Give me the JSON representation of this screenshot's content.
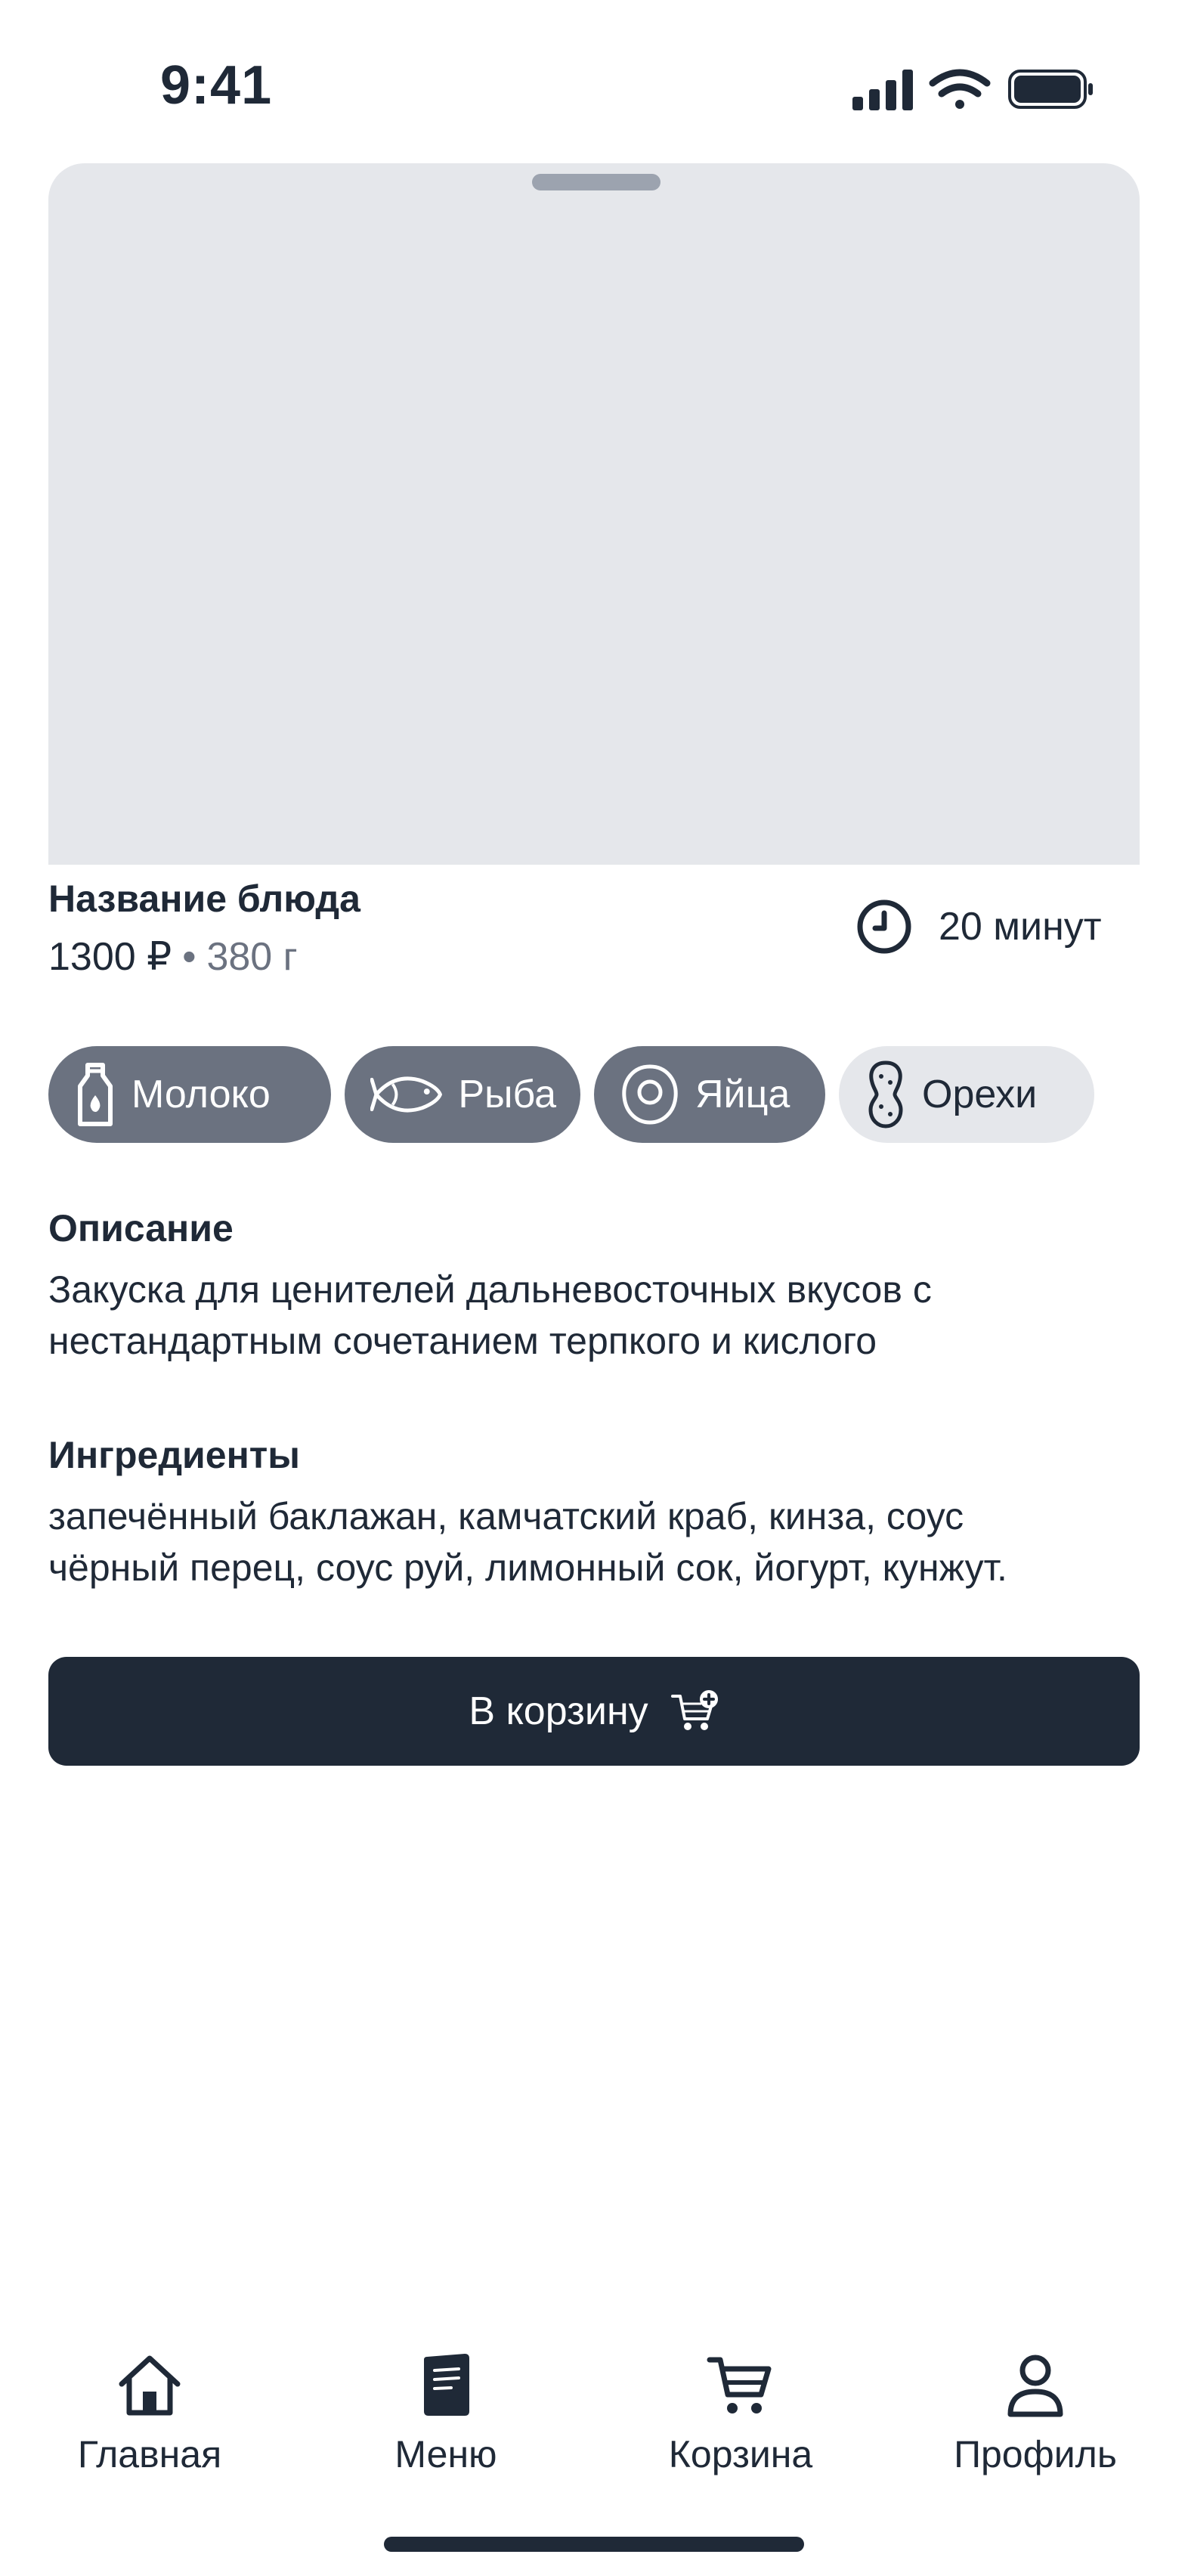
{
  "status_bar": {
    "time": "9:41"
  },
  "dish": {
    "name": "Название блюда",
    "price": "1300 ₽",
    "separator": "•",
    "weight": "380 г",
    "cook_time": "20 минут"
  },
  "allergens": [
    {
      "label": "Молоко",
      "icon": "milk-bottle-icon",
      "state": "active"
    },
    {
      "label": "Рыба",
      "icon": "fish-icon",
      "state": "active"
    },
    {
      "label": "Яйца",
      "icon": "egg-icon",
      "state": "active"
    },
    {
      "label": "Орехи",
      "icon": "peanut-icon",
      "state": "inactive"
    }
  ],
  "description": {
    "title": "Описание",
    "text_line1": "Закуска для ценителей дальневосточных вкусов с",
    "text_line2": "нестандартным сочетанием терпкого и кислого"
  },
  "ingredients": {
    "title": "Ингредиенты",
    "text_line1": "запечённый баклажан, камчатский краб, кинза, соус",
    "text_line2": "чёрный перец, соус руй, лимонный сок, йогурт, кунжут."
  },
  "cart_button": {
    "label": "В корзину",
    "icon": "cart-plus-icon"
  },
  "bottom_nav": [
    {
      "label": "Главная",
      "icon": "home-icon"
    },
    {
      "label": "Меню",
      "icon": "menu-book-icon"
    },
    {
      "label": "Корзина",
      "icon": "cart-icon"
    },
    {
      "label": "Профиль",
      "icon": "profile-icon"
    }
  ],
  "colors": {
    "primary_dark": "#1F2937",
    "chip_active": "#6B7280",
    "chip_inactive": "#E5E7EB",
    "placeholder": "#E5E7EB",
    "muted_text": "#6B7280"
  }
}
